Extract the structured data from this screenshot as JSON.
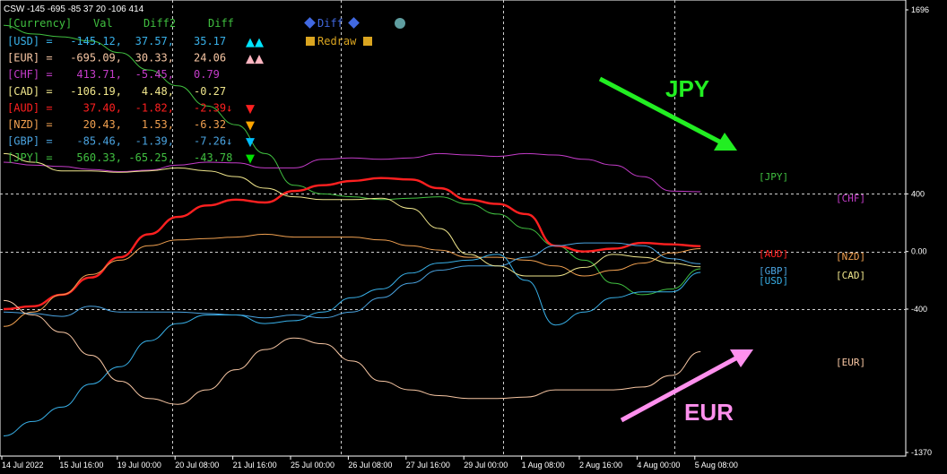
{
  "header": {
    "title": "CSW -145 -695 -85 37 20 -106 414"
  },
  "table": {
    "headers": [
      "[Currency]",
      "Val",
      "Diff2",
      "Diff"
    ],
    "rows": [
      {
        "currency": "[USD]",
        "val": "-145.12,",
        "diff2": "37.57,",
        "diff": "35.17",
        "marker": "▲▲",
        "color": "#38b0e8",
        "marker_color": "#00e5ff"
      },
      {
        "currency": "[EUR]",
        "val": "-695.09,",
        "diff2": "30.33,",
        "diff": "24.06",
        "marker": "▲▲",
        "color": "#f7c6a3",
        "marker_color": "#ffb6c1"
      },
      {
        "currency": "[CHF]",
        "val": "413.71,",
        "diff2": "-5.45,",
        "diff": "0.79",
        "marker": "",
        "color": "#c43cc9",
        "marker_color": ""
      },
      {
        "currency": "[CAD]",
        "val": "-106.19,",
        "diff2": "4.48,",
        "diff": "-0.27",
        "marker": "",
        "color": "#f0e68c",
        "marker_color": ""
      },
      {
        "currency": "[AUD]",
        "val": "37.40,",
        "diff2": "-1.82,",
        "diff": "-2.39↓",
        "marker": "▼",
        "color": "#ff2020",
        "marker_color": "#ff2020"
      },
      {
        "currency": "[NZD]",
        "val": "20.43,",
        "diff2": "1.53,",
        "diff": "-6.32",
        "marker": "▼",
        "color": "#f0a050",
        "marker_color": "#ffa500"
      },
      {
        "currency": "[GBP]",
        "val": "-85.46,",
        "diff2": "-1.39,",
        "diff": "-7.26↓",
        "marker": "▼",
        "color": "#4aa3e0",
        "marker_color": "#00bfff"
      },
      {
        "currency": "[JPY]",
        "val": "560.33,",
        "diff2": "-65.25,",
        "diff": "-43.78",
        "marker": "▼",
        "color": "#40c040",
        "marker_color": "#00e000"
      }
    ]
  },
  "buttons": {
    "diff": "Diff",
    "redraw": "Redraw"
  },
  "annotations": {
    "jpy": "JPY",
    "eur": "EUR"
  },
  "colors": {
    "USD": "#38b0e8",
    "EUR": "#f7c6a3",
    "CHF": "#c43cc9",
    "CAD": "#f0e68c",
    "AUD": "#ff2020",
    "NZD": "#f0a050",
    "GBP": "#4aa3e0",
    "JPY": "#40c040",
    "jpy_arrow": "#22ee22",
    "eur_arrow": "#ff90ee",
    "grid": "#cfcfcf",
    "axis": "#ffffff"
  },
  "chart_data": {
    "type": "line",
    "ylim": [
      -1370,
      1696
    ],
    "y_ticks": [
      "1696",
      "400",
      "0.00",
      "-400",
      "-1370"
    ],
    "y_tick_values": [
      1696,
      400,
      0,
      -400,
      -1370
    ],
    "x_tick_labels": [
      "14 Jul 2022",
      "15 Jul 16:00",
      "19 Jul 00:00",
      "20 Jul 08:00",
      "21 Jul 16:00",
      "25 Jul 00:00",
      "26 Jul 08:00",
      "27 Jul 16:00",
      "29 Jul 00:00",
      "1 Aug 08:00",
      "2 Aug 16:00",
      "4 Aug 00:00",
      "5 Aug 08:00"
    ],
    "x_range": [
      0,
      13
    ],
    "label_order": [
      "JPY",
      "CHF",
      "AUD",
      "NZD",
      "GBP",
      "USD",
      "CAD",
      "EUR"
    ],
    "series": [
      {
        "name": "[JPY]",
        "points": [
          [
            0,
            1570
          ],
          [
            0.5,
            1510
          ],
          [
            1,
            1490
          ],
          [
            1.5,
            1460
          ],
          [
            2,
            1380
          ],
          [
            2.5,
            1260
          ],
          [
            3,
            1150
          ],
          [
            3.5,
            1010
          ],
          [
            4,
            880
          ],
          [
            4.5,
            680
          ],
          [
            5,
            460
          ],
          [
            5.5,
            400
          ],
          [
            6,
            380
          ],
          [
            6.5,
            360
          ],
          [
            7,
            370
          ],
          [
            7.5,
            380
          ],
          [
            8,
            330
          ],
          [
            8.5,
            260
          ],
          [
            9,
            160
          ],
          [
            9.5,
            40
          ],
          [
            10,
            -60
          ],
          [
            10.5,
            -220
          ],
          [
            11,
            -300
          ],
          [
            11.5,
            -260
          ],
          [
            12,
            -120
          ]
        ]
      },
      {
        "name": "[CHF]",
        "points": [
          [
            0,
            620
          ],
          [
            0.5,
            600
          ],
          [
            1,
            590
          ],
          [
            1.5,
            570
          ],
          [
            2,
            555
          ],
          [
            2.5,
            565
          ],
          [
            3,
            600
          ],
          [
            3.5,
            620
          ],
          [
            4,
            615
          ],
          [
            4.5,
            580
          ],
          [
            5,
            580
          ],
          [
            5.5,
            640
          ],
          [
            6,
            650
          ],
          [
            6.5,
            640
          ],
          [
            7,
            650
          ],
          [
            7.5,
            680
          ],
          [
            8,
            670
          ],
          [
            8.5,
            660
          ],
          [
            9,
            680
          ],
          [
            9.5,
            670
          ],
          [
            10,
            640
          ],
          [
            10.5,
            600
          ],
          [
            11,
            520
          ],
          [
            11.5,
            420
          ],
          [
            12,
            415
          ]
        ]
      },
      {
        "name": "[AUD]",
        "points": [
          [
            0,
            -400
          ],
          [
            0.5,
            -380
          ],
          [
            1,
            -300
          ],
          [
            1.5,
            -180
          ],
          [
            2,
            -40
          ],
          [
            2.5,
            120
          ],
          [
            3,
            240
          ],
          [
            3.5,
            320
          ],
          [
            4,
            360
          ],
          [
            4.5,
            340
          ],
          [
            5,
            420
          ],
          [
            5.5,
            460
          ],
          [
            6,
            490
          ],
          [
            6.5,
            510
          ],
          [
            7,
            500
          ],
          [
            7.5,
            440
          ],
          [
            8,
            360
          ],
          [
            8.5,
            330
          ],
          [
            9,
            260
          ],
          [
            9.5,
            40
          ],
          [
            10,
            0
          ],
          [
            10.5,
            20
          ],
          [
            11,
            60
          ],
          [
            11.5,
            50
          ],
          [
            12,
            37
          ]
        ]
      },
      {
        "name": "[NZD]",
        "points": [
          [
            0,
            -520
          ],
          [
            0.5,
            -420
          ],
          [
            1,
            -300
          ],
          [
            1.5,
            -160
          ],
          [
            2,
            -60
          ],
          [
            2.5,
            40
          ],
          [
            3,
            80
          ],
          [
            3.5,
            90
          ],
          [
            4,
            100
          ],
          [
            4.5,
            120
          ],
          [
            5,
            100
          ],
          [
            5.5,
            100
          ],
          [
            6,
            100
          ],
          [
            6.5,
            80
          ],
          [
            7,
            40
          ],
          [
            7.5,
            10
          ],
          [
            8,
            -40
          ],
          [
            8.5,
            -40
          ],
          [
            9,
            -60
          ],
          [
            9.5,
            -100
          ],
          [
            10,
            -170
          ],
          [
            10.5,
            -130
          ],
          [
            11,
            -80
          ],
          [
            11.5,
            -10
          ],
          [
            12,
            20
          ]
        ]
      },
      {
        "name": "[GBP]",
        "points": [
          [
            0,
            -420
          ],
          [
            0.5,
            -430
          ],
          [
            1,
            -450
          ],
          [
            1.5,
            -380
          ],
          [
            2,
            -420
          ],
          [
            2.5,
            -420
          ],
          [
            3,
            -420
          ],
          [
            3.5,
            -430
          ],
          [
            4,
            -440
          ],
          [
            4.5,
            -460
          ],
          [
            5,
            -440
          ],
          [
            5.5,
            -460
          ],
          [
            6,
            -420
          ],
          [
            6.5,
            -320
          ],
          [
            7,
            -220
          ],
          [
            7.5,
            -130
          ],
          [
            8,
            -100
          ],
          [
            8.5,
            -100
          ],
          [
            9,
            -40
          ],
          [
            9.5,
            40
          ],
          [
            10,
            60
          ],
          [
            10.5,
            60
          ],
          [
            11,
            40
          ],
          [
            11.5,
            -50
          ],
          [
            12,
            -85
          ]
        ]
      },
      {
        "name": "[USD]",
        "points": [
          [
            0,
            -1280
          ],
          [
            0.5,
            -1180
          ],
          [
            1,
            -1080
          ],
          [
            1.5,
            -920
          ],
          [
            2,
            -800
          ],
          [
            2.5,
            -620
          ],
          [
            3,
            -500
          ],
          [
            3.5,
            -440
          ],
          [
            4,
            -440
          ],
          [
            4.5,
            -500
          ],
          [
            5,
            -480
          ],
          [
            5.5,
            -420
          ],
          [
            6,
            -320
          ],
          [
            6.5,
            -260
          ],
          [
            7,
            -150
          ],
          [
            7.5,
            -80
          ],
          [
            8,
            -60
          ],
          [
            8.5,
            -20
          ],
          [
            9,
            -200
          ],
          [
            9.5,
            -510
          ],
          [
            10,
            -420
          ],
          [
            10.5,
            -320
          ],
          [
            11,
            -280
          ],
          [
            11.5,
            -280
          ],
          [
            12,
            -145
          ]
        ]
      },
      {
        "name": "[CAD]",
        "points": [
          [
            0,
            680
          ],
          [
            0.5,
            620
          ],
          [
            1,
            560
          ],
          [
            1.5,
            560
          ],
          [
            2,
            550
          ],
          [
            2.5,
            560
          ],
          [
            3,
            580
          ],
          [
            3.5,
            560
          ],
          [
            4,
            520
          ],
          [
            4.5,
            440
          ],
          [
            5,
            380
          ],
          [
            5.5,
            360
          ],
          [
            6,
            360
          ],
          [
            6.5,
            370
          ],
          [
            7,
            300
          ],
          [
            7.5,
            160
          ],
          [
            8,
            -20
          ],
          [
            8.5,
            -100
          ],
          [
            9,
            -170
          ],
          [
            9.5,
            -170
          ],
          [
            10,
            -110
          ],
          [
            10.5,
            -20
          ],
          [
            11,
            -40
          ],
          [
            11.5,
            -80
          ],
          [
            12,
            -106
          ]
        ]
      },
      {
        "name": "[EUR]",
        "points": [
          [
            0,
            -340
          ],
          [
            0.5,
            -440
          ],
          [
            1,
            -560
          ],
          [
            1.5,
            -720
          ],
          [
            2,
            -900
          ],
          [
            2.5,
            -1020
          ],
          [
            3,
            -1060
          ],
          [
            3.5,
            -960
          ],
          [
            4,
            -820
          ],
          [
            4.5,
            -680
          ],
          [
            5,
            -600
          ],
          [
            5.5,
            -640
          ],
          [
            6,
            -760
          ],
          [
            6.5,
            -900
          ],
          [
            7,
            -960
          ],
          [
            7.5,
            -1000
          ],
          [
            8,
            -1020
          ],
          [
            8.5,
            -1020
          ],
          [
            9,
            -1010
          ],
          [
            9.5,
            -960
          ],
          [
            10,
            -960
          ],
          [
            10.5,
            -960
          ],
          [
            11,
            -940
          ],
          [
            11.5,
            -860
          ],
          [
            12,
            -695
          ]
        ]
      }
    ]
  }
}
